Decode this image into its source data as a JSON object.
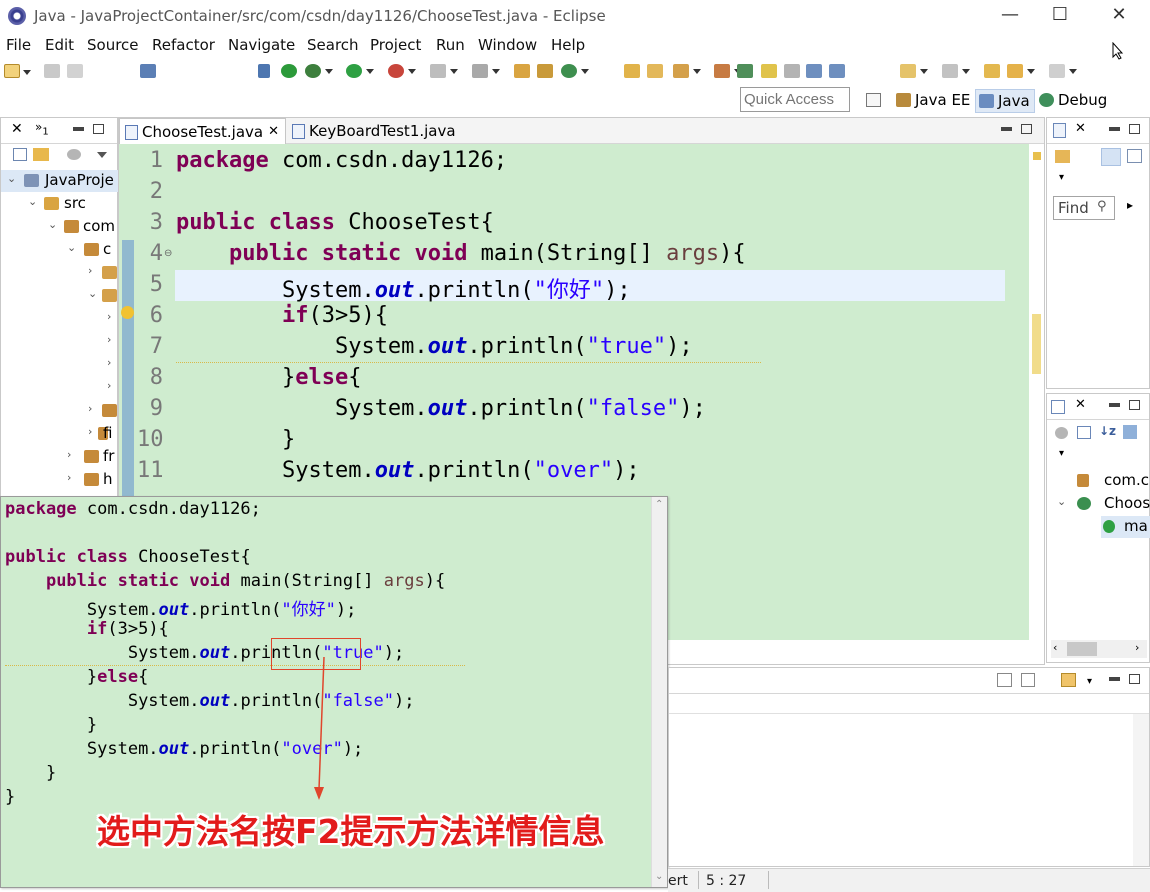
{
  "window": {
    "title": "Java - JavaProjectContainer/src/com/csdn/day1126/ChooseTest.java - Eclipse",
    "minimize": "—",
    "maximize": "☐",
    "close": "✕"
  },
  "menu": [
    "File",
    "Edit",
    "Source",
    "Refactor",
    "Navigate",
    "Search",
    "Project",
    "Run",
    "Window",
    "Help"
  ],
  "quick_access": {
    "placeholder": "Quick Access"
  },
  "perspectives": [
    {
      "label": "Java EE",
      "active": false
    },
    {
      "label": "Java",
      "active": true
    },
    {
      "label": "Debug",
      "active": false
    }
  ],
  "package_explorer": {
    "tab_count": "1",
    "tree": [
      {
        "label": "JavaProje",
        "twisty": "⌄"
      },
      {
        "label": "src",
        "twisty": "⌄"
      },
      {
        "label": "com",
        "twisty": "⌄"
      },
      {
        "label": "c",
        "twisty": "⌄"
      },
      {
        "label": "",
        "twisty": "›"
      },
      {
        "label": "",
        "twisty": "⌄"
      },
      {
        "label": "",
        "twisty": "›"
      },
      {
        "label": "",
        "twisty": "›"
      },
      {
        "label": "",
        "twisty": "›"
      },
      {
        "label": "",
        "twisty": "›"
      },
      {
        "label": "",
        "twisty": "›"
      },
      {
        "label": "fi",
        "twisty": "›"
      },
      {
        "label": "fr",
        "twisty": "›"
      },
      {
        "label": "h",
        "twisty": "›"
      }
    ]
  },
  "editor": {
    "tabs": [
      {
        "label": "ChooseTest.java",
        "active": true
      },
      {
        "label": "KeyBoardTest1.java",
        "active": false
      }
    ],
    "line_numbers": [
      "1",
      "2",
      "3",
      "4",
      "5",
      "6",
      "7",
      "8",
      "9",
      "10",
      "11"
    ],
    "code": {
      "l1_kw": "package",
      "l1_rest": " com.csdn.day1126;",
      "l3_kw1": "public",
      "l3_kw2": "class",
      "l3_rest": " ChooseTest{",
      "l4_kw1": "public",
      "l4_kw2": "static",
      "l4_kw3": "void",
      "l4_mid": " main(String[] ",
      "l4_param": "args",
      "l4_end": "){",
      "l5_a": "System.",
      "l5_field": "out",
      "l5_b": ".println(",
      "l5_str": "\"你好\"",
      "l5_c": ");",
      "l6_kw": "if",
      "l6_rest": "(3>5){",
      "l7_a": "System.",
      "l7_field": "out",
      "l7_b": ".println(",
      "l7_str": "\"true\"",
      "l7_c": ");",
      "l8_a": "}",
      "l8_kw": "else",
      "l8_b": "{",
      "l9_a": "System.",
      "l9_field": "out",
      "l9_b": ".println(",
      "l9_str": "\"false\"",
      "l9_c": ");",
      "l10": "}",
      "l11_a": "System.",
      "l11_field": "out",
      "l11_b": ".println(",
      "l11_str": "\"over\"",
      "l11_c": ");"
    }
  },
  "hover_popup": {
    "lines": {
      "p1_kw": "package",
      "p1_rest": " com.csdn.day1126;",
      "p3_kw1": "public",
      "p3_kw2": "class",
      "p3_rest": " ChooseTest{",
      "p4_kw1": "public",
      "p4_kw2": "static",
      "p4_kw3": "void",
      "p4_mid": " main(String[] ",
      "p4_param": "args",
      "p4_end": "){",
      "p5_a": "System.",
      "p5_field": "out",
      "p5_b": ".println(",
      "p5_str": "\"你好\"",
      "p5_c": ");",
      "p6_kw": "if",
      "p6_rest": "(3>5){",
      "p7_a": "System.",
      "p7_field": "out",
      "p7_b": ".println(",
      "p7_str": "\"true\"",
      "p7_c": ");",
      "p8_a": "}",
      "p8_kw": "else",
      "p8_b": "{",
      "p9_a": "System.",
      "p9_field": "out",
      "p9_b": ".println(",
      "p9_str": "\"false\"",
      "p9_c": ");",
      "p10": "}",
      "p11_a": "System.",
      "p11_field": "out",
      "p11_b": ".println(",
      "p11_str": "\"over\"",
      "p11_c": ");",
      "p12": "}",
      "p13": "}"
    },
    "annotation_caption": "选中方法名按F2提示方法详情信息"
  },
  "outline_top": {
    "find_label": "Find"
  },
  "outline_bottom": {
    "items": [
      "com.c",
      "Choos",
      "ma"
    ]
  },
  "status": {
    "insert_mode": "ert",
    "position": "5 : 27"
  },
  "colors": {
    "editor_bg": "#cfeccf",
    "keyword": "#7f0055",
    "string": "#2a00ff",
    "field": "#0000c0",
    "annotation": "#e21b1b"
  }
}
